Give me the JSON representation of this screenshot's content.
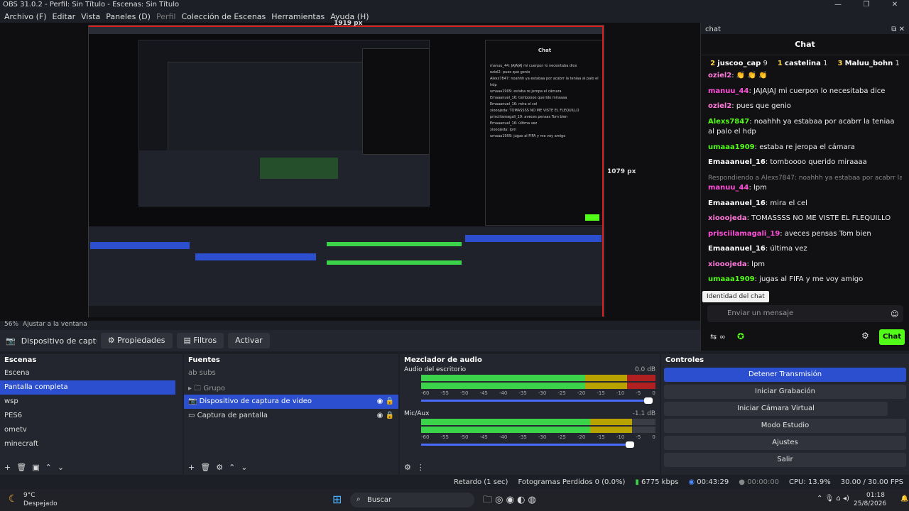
{
  "window": {
    "title": "OBS 31.0.2 - Perfil: Sin Título - Escenas: Sin Título"
  },
  "menu": [
    "Archivo (F)",
    "Editar",
    "Vista",
    "Paneles (D)",
    "Perfil",
    "Colección de Escenas",
    "Herramientas",
    "Ayuda (H)"
  ],
  "preview": {
    "width_label": "1919 px",
    "height_label": "1079 px",
    "zoom": "56%",
    "fit": "Ajustar a la ventana"
  },
  "source_toolbar": {
    "selected": "Dispositivo de captura de v",
    "properties": "Propiedades",
    "filters": "Filtros",
    "activate": "Activar"
  },
  "chat": {
    "dock_title": "chat",
    "title": "Chat",
    "podium": [
      {
        "rank": "2",
        "name": "juscoo_cap",
        "count": "9"
      },
      {
        "rank": "1",
        "name": "castelina",
        "count": "1"
      },
      {
        "rank": "3",
        "name": "Maluu_bohn",
        "count": "1"
      }
    ],
    "messages": [
      {
        "user": "oziel2",
        "text": ""
      },
      {
        "user": "manuu_44",
        "text": "JAJAJAJ mi cuerpon lo necesitaba dice"
      },
      {
        "user": "oziel2",
        "text": "pues que genio"
      },
      {
        "user": "Alexs7847",
        "text": "noahhh ya estabaa por acabrr la teniaa al palo el hdp"
      },
      {
        "user": "umaaa1909",
        "text": "estaba re jeropa el cámara"
      },
      {
        "user": "Emaaanuel_16",
        "text": "tomboooo querido miraaaa"
      },
      {
        "reply": "Respondiendo a Alexs7847: noahhh ya estabaa por acabrr la teniaa al palo el hdp"
      },
      {
        "user": "manuu_44",
        "text": "lpm"
      },
      {
        "user": "Emaaanuel_16",
        "text": "mira el cel"
      },
      {
        "user": "xiooojeda",
        "text": "TOMASSSS NO ME VISTE EL FLEQUILLO"
      },
      {
        "user": "prisciilamagali_19",
        "text": "aveces pensas Tom bien"
      },
      {
        "user": "Emaaanuel_16",
        "text": "última vez"
      },
      {
        "user": "xiooojeda",
        "text": "lpm"
      },
      {
        "user": "umaaa1909",
        "text": "jugas al FIFA y me voy amigo"
      }
    ],
    "tooltip": "Identidad del chat",
    "input_placeholder": "Enviar un mensaje",
    "send": "Chat"
  },
  "scenes": {
    "title": "Escenas",
    "items": [
      "Escena",
      "Pantalla completa",
      "wsp",
      "PES6",
      "ometv",
      "minecraft"
    ],
    "selected": 1
  },
  "sources": {
    "title": "Fuentes",
    "items": [
      "subs",
      "Grupo",
      "Dispositivo de captura de video",
      "Captura de pantalla"
    ],
    "selected": 2
  },
  "mixer": {
    "title": "Mezclador de audio",
    "channels": [
      {
        "name": "Audio del escritorio",
        "db": "0.0 dB",
        "level": 0.5
      },
      {
        "name": "Mic/Aux",
        "db": "-1.1 dB",
        "level": 0.75
      }
    ],
    "ticks": [
      "-60",
      "-55",
      "-50",
      "-45",
      "-40",
      "-35",
      "-30",
      "-25",
      "-20",
      "-15",
      "-10",
      "-5",
      "0"
    ]
  },
  "controls": {
    "title": "Controles",
    "buttons": [
      "Detener Transmisión",
      "Iniciar Grabación",
      "Iniciar Cámara Virtual",
      "Modo Estudio",
      "Ajustes",
      "Salir"
    ]
  },
  "status": {
    "delay": "Retardo (1 sec)",
    "dropped": "Fotogramas Perdidos 0 (0.0%)",
    "bitrate": "6775 kbps",
    "live_time": "00:43:29",
    "rec_time": "00:00:00",
    "cpu": "CPU: 13.9%",
    "fps": "30.00 / 30.00 FPS"
  },
  "taskbar": {
    "temp": "9°C",
    "weather": "Despejado",
    "search": "Buscar",
    "time": "01:18",
    "date": "25/8/2026"
  }
}
